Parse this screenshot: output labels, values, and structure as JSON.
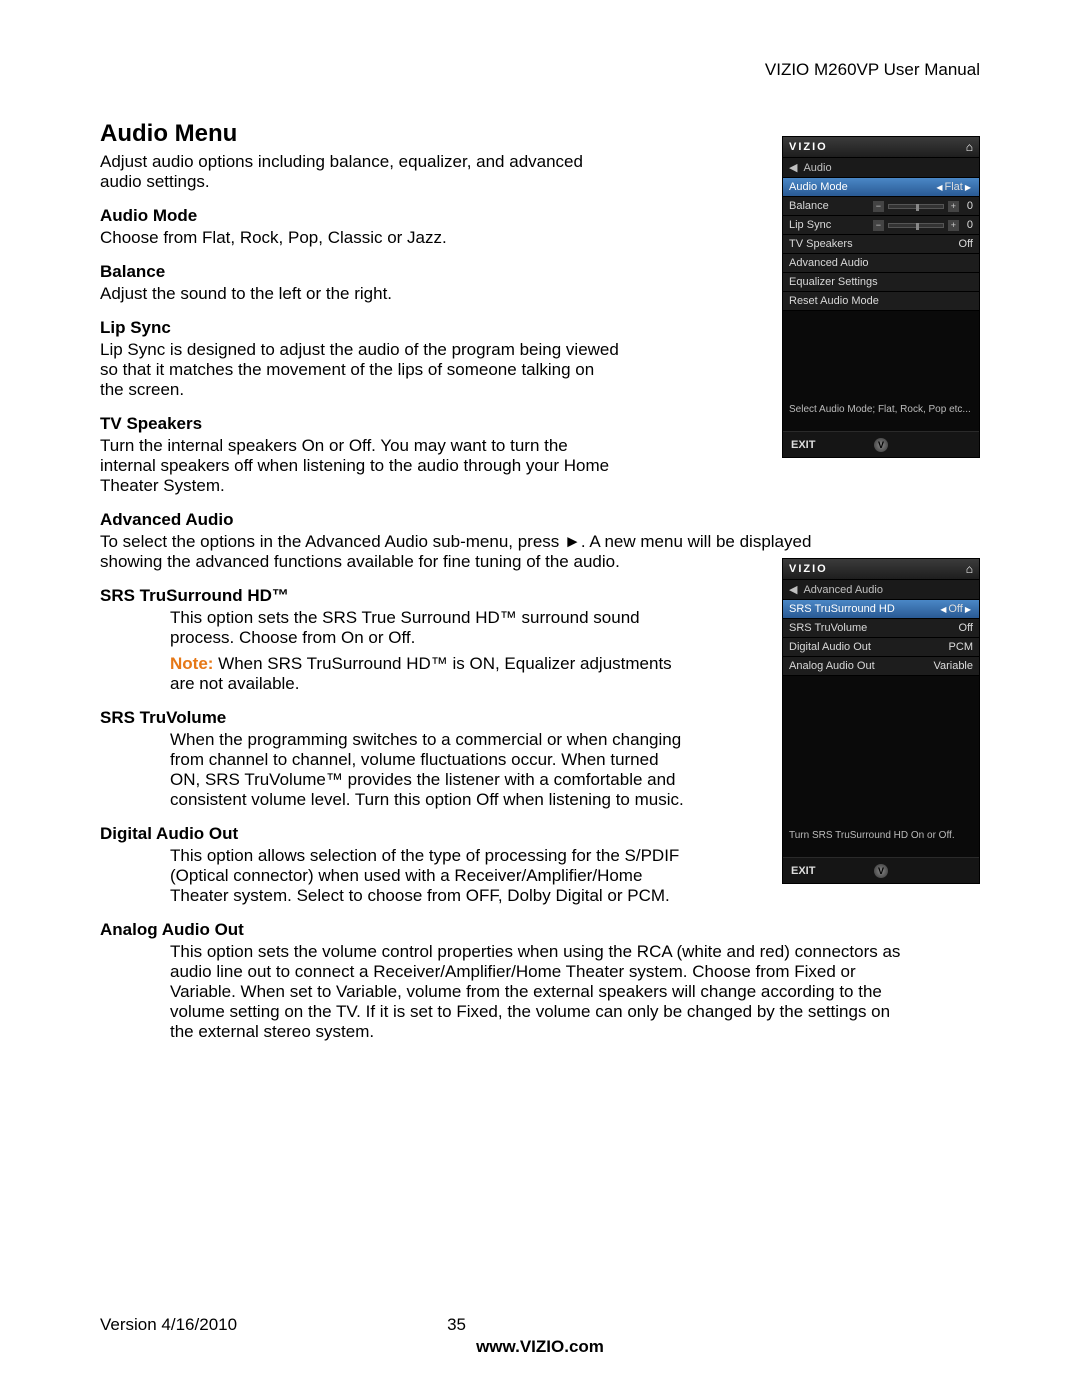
{
  "header": {
    "manual_title": "VIZIO M260VP User Manual"
  },
  "title": "Audio Menu",
  "intro": "Adjust audio options including balance, equalizer, and advanced audio settings.",
  "sections": {
    "audio_mode": {
      "h": "Audio Mode",
      "p": "Choose from Flat, Rock, Pop, Classic or Jazz."
    },
    "balance": {
      "h": "Balance",
      "p": "Adjust the sound to the left or the right."
    },
    "lip_sync": {
      "h": "Lip Sync",
      "p": "Lip Sync is designed to adjust the audio of the program being viewed so that it matches the movement of the lips of someone talking on the screen."
    },
    "tv_speakers": {
      "h": "TV Speakers",
      "p": "Turn the internal speakers On or Off. You may want to turn the internal speakers off when listening to the audio through your Home Theater System."
    },
    "advanced_audio": {
      "h": "Advanced Audio",
      "p": "To select the options in the Advanced Audio sub-menu, press ►. A new menu will be displayed showing the advanced functions available for fine tuning of the audio."
    },
    "srs_ts": {
      "h": "SRS TruSurround HD™",
      "p1": "This option sets the SRS True Surround HD™ surround sound process. Choose from On or Off.",
      "note_label": "Note:",
      "note": " When SRS TruSurround HD™ is ON, Equalizer adjustments are not available."
    },
    "srs_tv": {
      "h": "SRS TruVolume",
      "p": "When the programming switches to a commercial or when changing from channel to channel, volume fluctuations occur. When turned ON, SRS TruVolume™ provides the listener with a comfortable and consistent volume level. Turn this option Off when listening to music."
    },
    "dao": {
      "h": "Digital Audio Out",
      "p": "This option allows selection of the type of processing for the S/PDIF (Optical connector) when used with a Receiver/Amplifier/Home Theater system. Select to choose from OFF, Dolby Digital or PCM."
    },
    "aao": {
      "h": "Analog Audio Out",
      "p": "This option sets the volume control properties when using the RCA (white and red) connectors as audio line out to connect a Receiver/Amplifier/Home Theater system. Choose from Fixed or Variable. When set to Variable, volume from the external speakers will change according to the volume setting on the TV. If it is set to Fixed, the volume can only be changed by the settings on the external stereo system."
    }
  },
  "osd1": {
    "brand": "VIZIO",
    "crumb": "Audio",
    "rows": [
      {
        "label": "Audio Mode",
        "value": "Flat",
        "selected": true,
        "arrows": true
      },
      {
        "label": "Balance",
        "value": "0",
        "slider": true
      },
      {
        "label": "Lip Sync",
        "value": "0",
        "slider": true
      },
      {
        "label": "TV Speakers",
        "value": "Off"
      },
      {
        "label": "Advanced Audio",
        "value": ""
      },
      {
        "label": "Equalizer Settings",
        "value": ""
      },
      {
        "label": "Reset Audio Mode",
        "value": ""
      }
    ],
    "hint": "Select Audio Mode; Flat, Rock, Pop etc...",
    "exit": "EXIT"
  },
  "osd2": {
    "brand": "VIZIO",
    "crumb": "Advanced Audio",
    "rows": [
      {
        "label": "SRS TruSurround HD",
        "value": "Off",
        "selected": true,
        "arrows": true
      },
      {
        "label": "SRS TruVolume",
        "value": "Off"
      },
      {
        "label": "Digital Audio Out",
        "value": "PCM"
      },
      {
        "label": "Analog Audio Out",
        "value": "Variable"
      }
    ],
    "hint": "Turn SRS TruSurround HD On or Off.",
    "exit": "EXIT"
  },
  "footer": {
    "version": "Version 4/16/2010",
    "page": "35",
    "url": "www.VIZIO.com"
  }
}
